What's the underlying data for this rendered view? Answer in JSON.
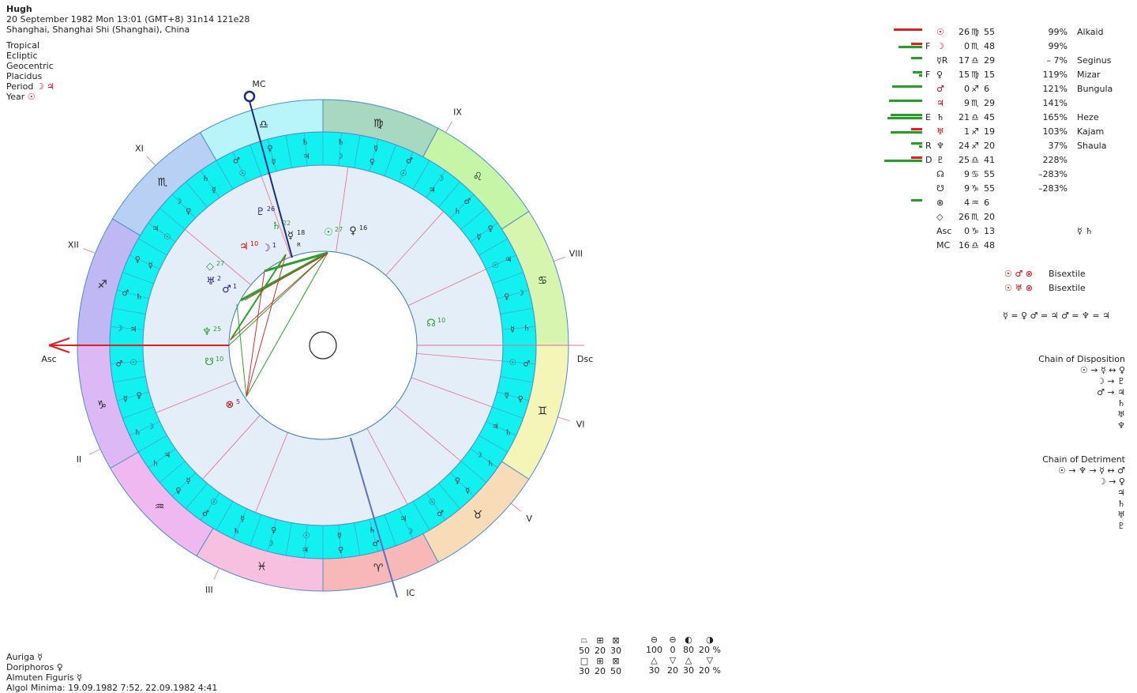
{
  "header": {
    "name": "Hugh",
    "line1": "20 September 1982  Mon  13:01 (GMT+8) 31n14  121e28",
    "line2": "Shanghai, Shanghai Shi (Shanghai), China"
  },
  "settings": {
    "zodiac": "Tropical",
    "coords": "Ecliptic",
    "center": "Geocentric",
    "houses": "Placidus",
    "period_label": "Period",
    "period_glyphs": "☽ ♃",
    "year_label": "Year",
    "year_glyph": "☉"
  },
  "axes": {
    "asc": "Asc",
    "dsc": "Dsc",
    "mc": "MC",
    "ic": "IC"
  },
  "houses": [
    "XI",
    "XII",
    "II",
    "III",
    "V",
    "VI",
    "VIII",
    "IX"
  ],
  "signs_ring": [
    "♎",
    "♍",
    "♌",
    "♋",
    "♊",
    "♉",
    "♈",
    "♓",
    "♒",
    "♑",
    "♐",
    "♏"
  ],
  "inner_planets": [
    {
      "glyph": "♇",
      "deg": "26",
      "color": "#1a1aa0"
    },
    {
      "glyph": "♄",
      "deg": "22",
      "color": "#2a9a2a"
    },
    {
      "glyph": "☿",
      "deg": "18",
      "color": "#222"
    },
    {
      "glyph": "☉",
      "deg": "27",
      "color": "#2a9a2a"
    },
    {
      "glyph": "♀",
      "deg": "16",
      "color": "#222"
    },
    {
      "glyph": "♃",
      "deg": "10",
      "color": "#d00000"
    },
    {
      "glyph": "☽",
      "deg": "1",
      "color": "#1a1aa0"
    },
    {
      "glyph": "◇",
      "deg": "27",
      "color": "#2a9a2a"
    },
    {
      "glyph": "♅",
      "deg": "2",
      "color": "#1a1aa0"
    },
    {
      "glyph": "♂",
      "deg": "1",
      "color": "#1a1aa0"
    },
    {
      "glyph": "♆",
      "deg": "25",
      "color": "#2a9a2a"
    },
    {
      "glyph": "☋",
      "deg": "10",
      "color": "#2a9a2a"
    },
    {
      "glyph": "☊",
      "deg": "10",
      "color": "#2a9a2a"
    },
    {
      "glyph": "⊗",
      "deg": "5",
      "color": "#d00000"
    }
  ],
  "retro_mark": "R",
  "planet_table": [
    {
      "dig": "",
      "glyph": "☉",
      "deg": "26",
      "sign": "♍",
      "min": "55",
      "pct": "99%",
      "star": "Alkaid"
    },
    {
      "dig": "F",
      "glyph": "☽",
      "deg": "0",
      "sign": "♏",
      "min": "48",
      "pct": "99%",
      "star": ""
    },
    {
      "dig": "",
      "glyph": "☿R",
      "deg": "17",
      "sign": "♎",
      "min": "29",
      "pct": "–   7%",
      "star": "Seginus"
    },
    {
      "dig": "F",
      "glyph": "♀",
      "deg": "15",
      "sign": "♍",
      "min": "15",
      "pct": "119%",
      "star": "Mizar"
    },
    {
      "dig": "",
      "glyph": "♂",
      "deg": "0",
      "sign": "♐",
      "min": "6",
      "pct": "121%",
      "star": "Bungula"
    },
    {
      "dig": "",
      "glyph": "♃",
      "deg": "9",
      "sign": "♏",
      "min": "29",
      "pct": "141%",
      "star": ""
    },
    {
      "dig": "E",
      "glyph": "♄",
      "deg": "21",
      "sign": "♎",
      "min": "45",
      "pct": "165%",
      "star": "Heze"
    },
    {
      "dig": "",
      "glyph": "♅",
      "deg": "1",
      "sign": "♐",
      "min": "19",
      "pct": "103%",
      "star": "Kajam"
    },
    {
      "dig": "R",
      "glyph": "♆",
      "deg": "24",
      "sign": "♐",
      "min": "20",
      "pct": "37%",
      "star": "Shaula"
    },
    {
      "dig": "D",
      "glyph": "♇",
      "deg": "25",
      "sign": "♎",
      "min": "41",
      "pct": "228%",
      "star": ""
    },
    {
      "dig": "",
      "glyph": "☊",
      "deg": "9",
      "sign": "♋",
      "min": "55",
      "pct": "–283%",
      "star": ""
    },
    {
      "dig": "",
      "glyph": "☋",
      "deg": "9",
      "sign": "♑",
      "min": "55",
      "pct": "–283%",
      "star": ""
    },
    {
      "dig": "",
      "glyph": "⊗",
      "deg": "4",
      "sign": "♒",
      "min": "6",
      "pct": "",
      "star": ""
    },
    {
      "dig": "",
      "glyph": "◇",
      "deg": "26",
      "sign": "♏",
      "min": "20",
      "pct": "",
      "star": ""
    },
    {
      "dig": "",
      "glyph": "Asc",
      "deg": "0",
      "sign": "♑",
      "min": "13",
      "pct": "",
      "star": "☿  ♄"
    },
    {
      "dig": "",
      "glyph": "MC",
      "deg": "16",
      "sign": "♎",
      "min": "48",
      "pct": "",
      "star": ""
    }
  ],
  "bisextiles": [
    {
      "glyphs": "☉ ♂ ⊗",
      "label": "Bisextile"
    },
    {
      "glyphs": "☉ ♅ ⊗",
      "label": "Bisextile"
    }
  ],
  "equations": "☿ = ♀  ♂ = ♃  ♂ = ♆ = ♃",
  "chain_disposition": {
    "title": "Chain of Disposition",
    "lines": [
      "☉ → ☿ ↔ ♀",
      "☽ → ♇",
      "♂ → ♃",
      "♄",
      "♅",
      "♆"
    ]
  },
  "chain_detriment": {
    "title": "Chain of Detriment",
    "lines": [
      "☉ → ♆ → ☿ ↔ ♂",
      "☽ → ♀",
      "♃",
      "♄",
      "♅",
      "♇"
    ]
  },
  "footer": {
    "auriga": "Auriga  ☿",
    "doriphoros": "Doriphoros  ♀",
    "almuten": "Almuten Figuris  ☿",
    "algol": "Algol Minima: 19.09.1982  7:52,  22.09.1982  4:41"
  },
  "quality_table": {
    "row1_glyphs": [
      "⏢",
      "⊞",
      "⊠"
    ],
    "row1_values": [
      "50",
      "20",
      "30"
    ],
    "row2_glyphs": [
      "□",
      "⊞",
      "⊠"
    ],
    "row2_values": [
      "30",
      "20",
      "50"
    ],
    "elem_glyphs": [
      "⊖",
      "⊖",
      "◐",
      "◑"
    ],
    "elem_values": [
      "100",
      "0",
      "80",
      "20 %"
    ],
    "tri_glyphs": [
      "△",
      "▽",
      "△",
      "▽"
    ],
    "tri_values": [
      "30",
      "20",
      "30",
      "20 %"
    ]
  }
}
